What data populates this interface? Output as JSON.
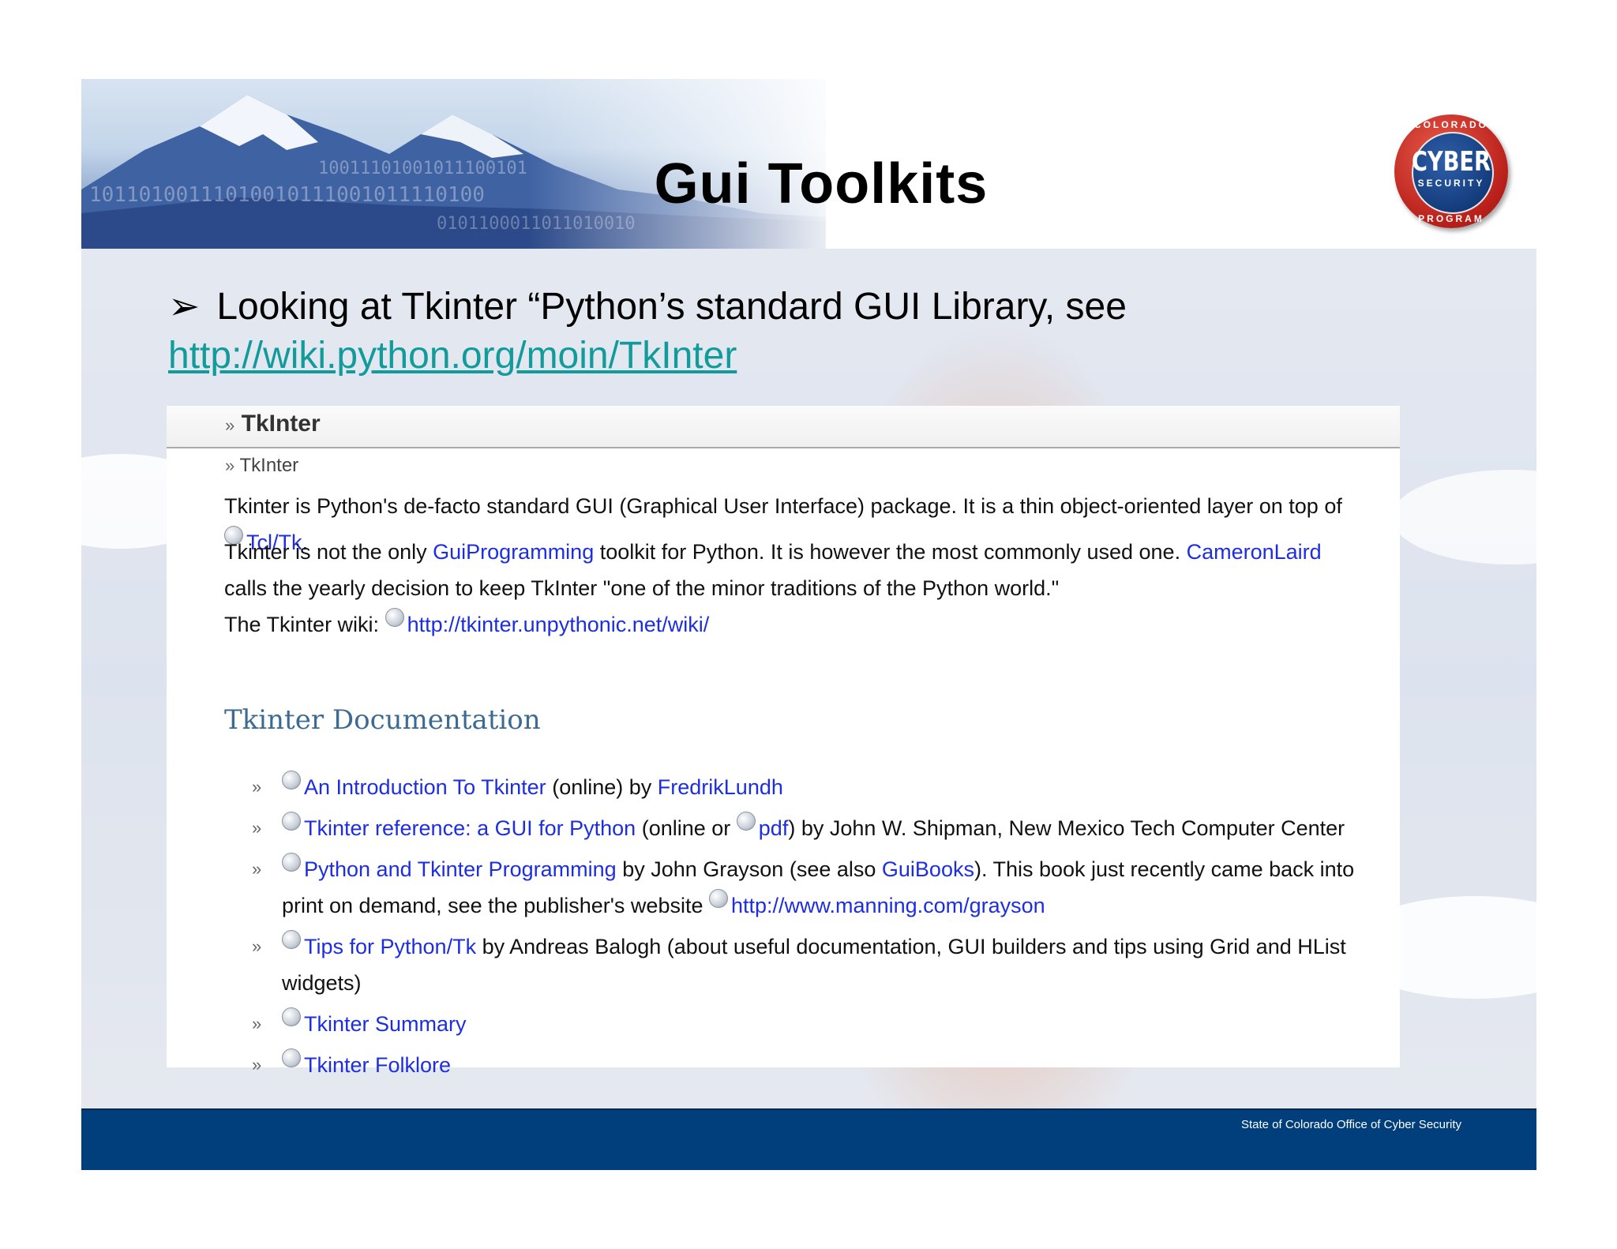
{
  "slide": {
    "title": "Gui Toolkits",
    "bullet": {
      "arrow": "➢",
      "text": "Looking at Tkinter “Python’s standard GUI Library, see",
      "url": "http://wiki.python.org/moin/TkInter"
    },
    "logo": {
      "top_text": "COLORADO",
      "main_text": "CYBER",
      "sub_text": "SECURITY",
      "bottom_text": "PROGRAM"
    },
    "footer": "State of Colorado Office of Cyber Security"
  },
  "wiki": {
    "header_chevron": "»",
    "header_title": "TkInter",
    "breadcrumb": "TkInter",
    "p1": {
      "text": "Tkinter is Python's de-facto standard GUI (Graphical User Interface) package. It is a thin object-oriented layer on top of",
      "link": "Tcl/Tk",
      "end": "."
    },
    "p2": {
      "pre": "Tkinter is not the only",
      "link1": "GuiProgramming",
      "mid": "toolkit for Python. It is however the most commonly used one.",
      "link2": "CameronLaird",
      "post": "calls the yearly decision to keep TkInter \"one of the minor traditions of the Python world.\""
    },
    "p3": {
      "pre": "The Tkinter wiki:",
      "link": "http://tkinter.unpythonic.net/wiki/"
    },
    "doc_heading": "Tkinter Documentation",
    "items": [
      {
        "link": "An Introduction To Tkinter",
        "text": "(online) by",
        "link2": "FredrikLundh"
      },
      {
        "link": "Tkinter reference: a GUI for Python",
        "text": "(online or",
        "link2": "pdf",
        "text2": ") by John W. Shipman, New Mexico Tech Computer Center"
      },
      {
        "link": "Python and Tkinter Programming",
        "text": "by John Grayson (see also",
        "link2": "GuiBooks",
        "text2": "). This book just recently came back into print on demand, see the publisher's website",
        "link3": "http://www.manning.com/grayson"
      },
      {
        "link": "Tips for Python/Tk",
        "text": "by Andreas Balogh (about useful documentation, GUI builders and tips using Grid and HList widgets)"
      },
      {
        "link": "Tkinter Summary"
      },
      {
        "link": "Tkinter Folklore"
      }
    ]
  },
  "colors": {
    "footer_bg": "#003f7c",
    "link": "#1c2ee0",
    "url": "#129b9b",
    "doc_heading": "#3d6a92",
    "logo_red": "#b81f1a",
    "logo_blue": "#123a7a"
  }
}
